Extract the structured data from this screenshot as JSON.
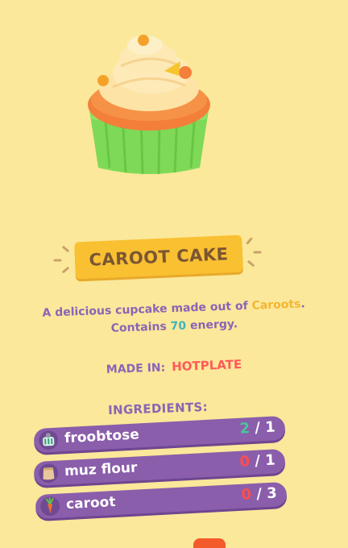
{
  "item": {
    "name": "CAROOT CAKE",
    "description_prefix": "A delicious cupcake made out of ",
    "description_highlight": "Caroots",
    "description_suffix": ".",
    "energy_prefix": "Contains ",
    "energy_value": "70",
    "energy_suffix": " energy."
  },
  "made_in": {
    "label": "MADE IN:",
    "value": "HOTPLATE"
  },
  "ingredients": {
    "heading": "INGREDIENTS:",
    "items": [
      {
        "name": "froobtose",
        "have": "2",
        "need": "/ 1",
        "icon": "froobtose-icon",
        "status": "ok"
      },
      {
        "name": "muz flour",
        "have": "0",
        "need": "/ 1",
        "icon": "flour-bag-icon",
        "status": "missing"
      },
      {
        "name": "caroot",
        "have": "0",
        "need": "/ 3",
        "icon": "caroot-icon",
        "status": "missing"
      }
    ]
  },
  "colors": {
    "background": "#fbe89a",
    "banner": "#f9c032",
    "text_purple": "#8a64b6",
    "accent_red": "#ff5a5a",
    "accent_teal": "#3cb3c2",
    "accent_yellow": "#f4b532",
    "row_purple": "#8a5eab"
  }
}
